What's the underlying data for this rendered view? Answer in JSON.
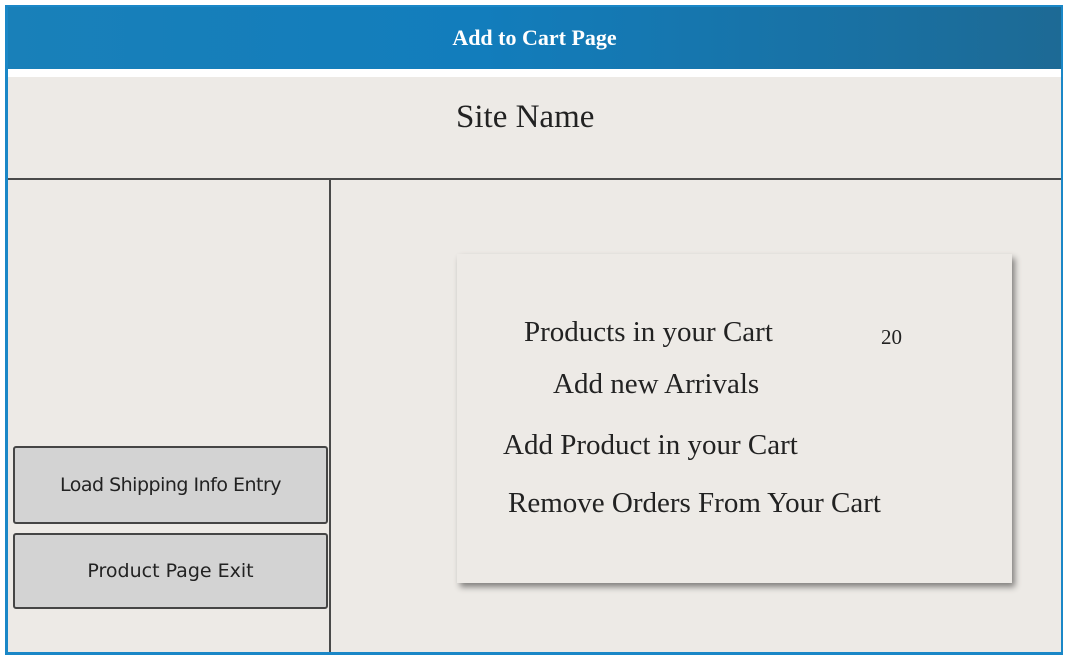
{
  "window": {
    "title": "Add to Cart Page"
  },
  "header": {
    "site_name": "Site Name"
  },
  "sidebar": {
    "buttons": [
      {
        "label": "Load Shipping Info Entry"
      },
      {
        "label": "Product Page Exit"
      }
    ]
  },
  "cart_panel": {
    "products_label": "Products in your Cart",
    "products_count": "20",
    "links": [
      {
        "label": "Add new Arrivals"
      },
      {
        "label": "Add Product in your Cart"
      },
      {
        "label": "Remove Orders From Your Cart"
      }
    ]
  },
  "colors": {
    "titlebar": "#127dbc",
    "frame_border": "#1a87c7",
    "panel_background": "#edeae6",
    "button_background": "#d3d3d3"
  }
}
